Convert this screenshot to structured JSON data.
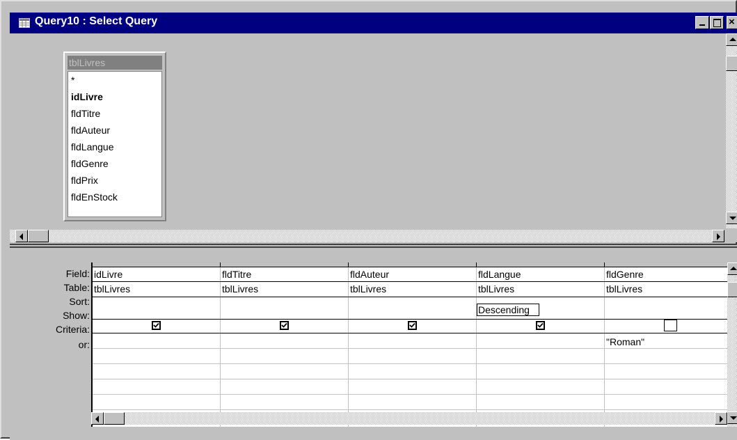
{
  "window": {
    "title": "Query10 : Select Query",
    "controls": {
      "minimize": "minimize",
      "maximize": "maximize",
      "close": "close"
    }
  },
  "field_list": {
    "table_name": "tblLivres",
    "fields": [
      "*",
      "idLivre",
      "fldTitre",
      "fldAuteur",
      "fldLangue",
      "fldGenre",
      "fldPrix",
      "fldEnStock"
    ],
    "primary_key": "idLivre"
  },
  "design_grid": {
    "row_labels": [
      "Field:",
      "Table:",
      "Sort:",
      "Show:",
      "Criteria:",
      "or:"
    ],
    "columns": [
      {
        "field": "idLivre",
        "table": "tblLivres",
        "sort": "",
        "show": true,
        "criteria": ""
      },
      {
        "field": "fldTitre",
        "table": "tblLivres",
        "sort": "",
        "show": true,
        "criteria": ""
      },
      {
        "field": "fldAuteur",
        "table": "tblLivres",
        "sort": "",
        "show": true,
        "criteria": ""
      },
      {
        "field": "fldLangue",
        "table": "tblLivres",
        "sort": "Descending",
        "show": true,
        "criteria": ""
      },
      {
        "field": "fldGenre",
        "table": "tblLivres",
        "sort": "",
        "show": false,
        "criteria": "\"Roman\""
      }
    ]
  },
  "colors": {
    "titlebar": "#000080",
    "face": "#c0c0c0",
    "grid_bg": "#ffffff"
  }
}
